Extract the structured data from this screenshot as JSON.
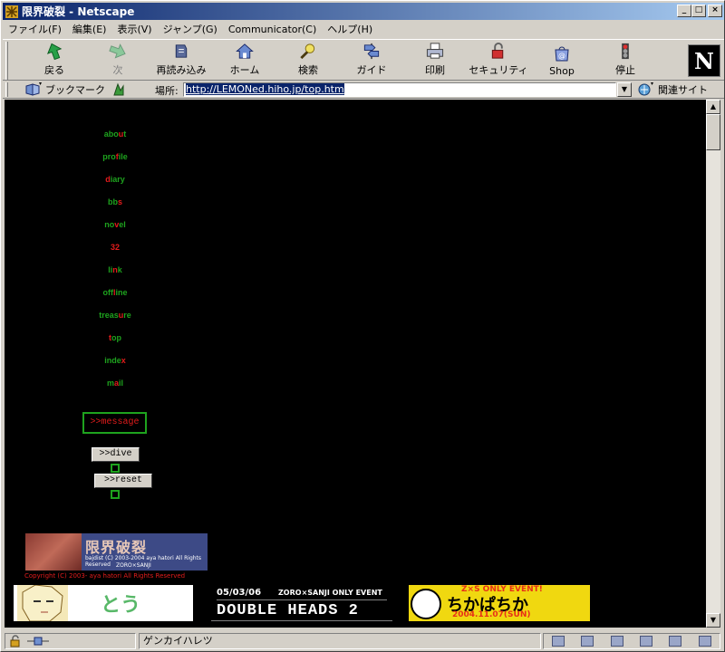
{
  "window": {
    "title": "限界破裂 - Netscape",
    "buttons": {
      "minimize": "_",
      "maximize": "□",
      "close": "×"
    }
  },
  "menu": [
    "ファイル(F)",
    "編集(E)",
    "表示(V)",
    "ジャンプ(G)",
    "Communicator(C)",
    "ヘルプ(H)"
  ],
  "toolbar": {
    "back": "戻る",
    "forward": "次",
    "reload": "再読み込み",
    "home": "ホーム",
    "search": "検索",
    "guide": "ガイド",
    "print": "印刷",
    "security": "セキュリティ",
    "shop": "Shop",
    "stop": "停止",
    "logo": "N"
  },
  "location": {
    "bookmarks": "ブックマーク",
    "label": "場所:",
    "url": "http://LEMONed.hiho.jp/top.htm",
    "related": "関連サイト"
  },
  "page": {
    "nav": [
      {
        "pre": "abo",
        "hl": "u",
        "post": "t"
      },
      {
        "pre": "pro",
        "hl": "f",
        "post": "ile"
      },
      {
        "pre": "",
        "hl": "d",
        "post": "iary"
      },
      {
        "pre": "bb",
        "hl": "s",
        "post": ""
      },
      {
        "pre": "no",
        "hl": "v",
        "post": "el"
      },
      {
        "pre": "",
        "hl": "32",
        "post": ""
      },
      {
        "pre": "li",
        "hl": "n",
        "post": "k"
      },
      {
        "pre": "off",
        "hl": "l",
        "post": "ine"
      },
      {
        "pre": "treas",
        "hl": "u",
        "post": "re"
      },
      {
        "pre": "",
        "hl": "t",
        "post": "op"
      },
      {
        "pre": "inde",
        "hl": "x",
        "post": ""
      },
      {
        "pre": "m",
        "hl": "a",
        "post": "il"
      }
    ],
    "message": ">>message",
    "dive": ">>dive",
    "reset": ">>reset",
    "banner_main": {
      "title": "限界破裂",
      "line1": "bajdist (C) 2003-2004 aya hatori All Rights Reserved",
      "line2": "ZORO×SANJI"
    },
    "copyright": "Copyright (C) 2003- aya hatori All Rights Reserved",
    "banner_tou": "とう",
    "banner_event": {
      "date": "05/03/06",
      "title": "ZORO×SANJI ONLY EVENT",
      "name": "DOUBLE HEADS 2"
    },
    "banner_chika": {
      "top": "Z×S ONLY EVENT!",
      "main": "ちかぱちか",
      "bottom": "2004.11.07(SUN)"
    }
  },
  "status": {
    "text": "ゲンカイハレツ"
  },
  "colors": {
    "green": "#1ea31e",
    "red": "#e21c1c",
    "title_bar": "#0a246a"
  }
}
